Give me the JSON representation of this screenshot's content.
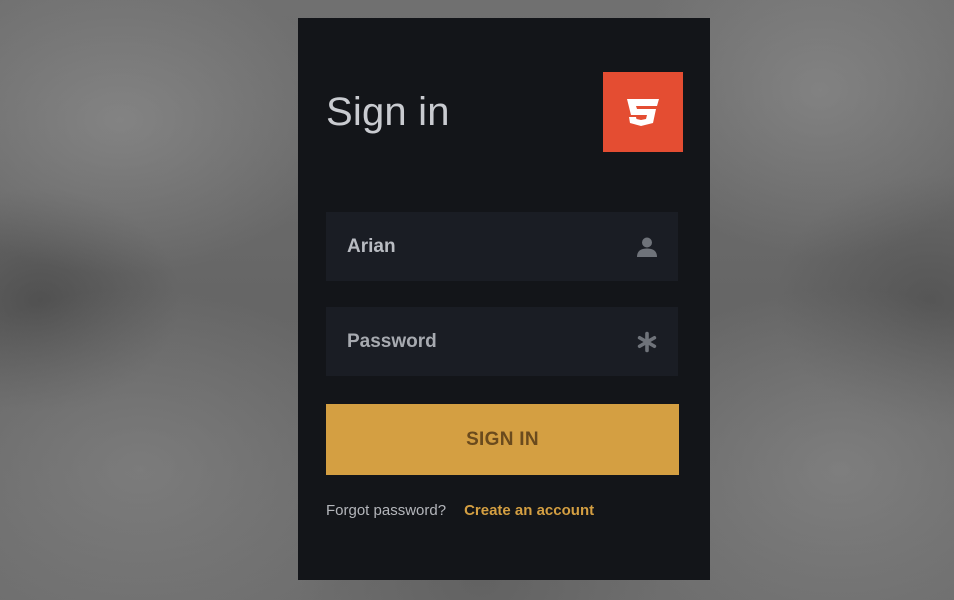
{
  "login": {
    "title": "Sign in",
    "username_value": "Arian",
    "password_placeholder": "Password",
    "signin_label": "SIGN IN",
    "forgot_label": "Forgot password?",
    "create_label": "Create an account"
  },
  "icons": {
    "logo": "html5-e-logo-icon",
    "username": "user-icon",
    "password": "asterisk-icon"
  },
  "colors": {
    "card_bg": "#131519",
    "field_bg": "#1a1d24",
    "accent": "#d49f42",
    "logo_bg": "#e44d32"
  }
}
